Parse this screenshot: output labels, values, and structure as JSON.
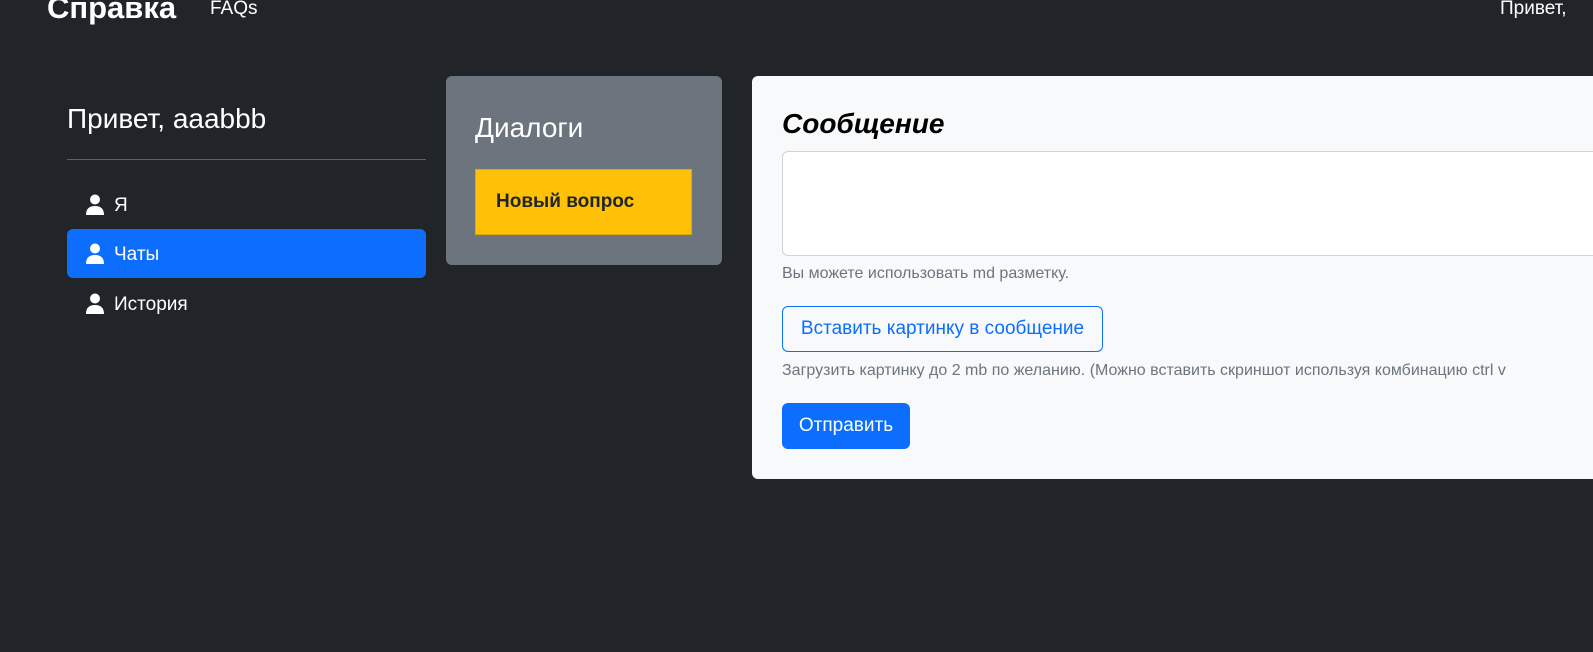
{
  "navbar": {
    "brand": "Справка",
    "links": [
      "FAQs"
    ],
    "greeting": "Привет,"
  },
  "sidebar": {
    "title": "Привет, aaabbb",
    "items": [
      {
        "label": "Я",
        "icon": "user-icon",
        "active": false
      },
      {
        "label": "Чаты",
        "icon": "user-icon",
        "active": true
      },
      {
        "label": "История",
        "icon": "user-icon",
        "active": false
      }
    ]
  },
  "dialogs": {
    "title": "Диалоги",
    "new_question_label": "Новый вопрос"
  },
  "message_form": {
    "title": "Сообщение",
    "textarea_value": "",
    "md_hint": "Вы можете использовать md разметку.",
    "insert_image_label": "Вставить картинку в сообщение",
    "upload_hint": "Загрузить картинку до 2 mb по желанию. (Можно вставить скриншот используя комбинацию ctrl v",
    "send_label": "Отправить"
  },
  "colors": {
    "background": "#212529",
    "primary": "#0d6efd",
    "warning": "#ffc107",
    "secondary": "#6c757d",
    "light": "#f8f9fa"
  }
}
